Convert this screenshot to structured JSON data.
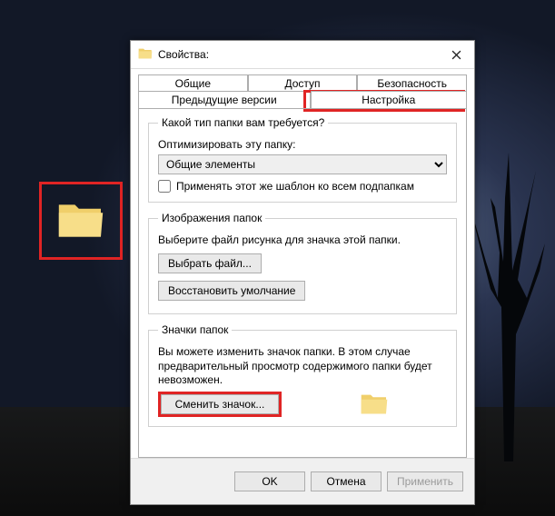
{
  "window": {
    "title": "Свойства:",
    "close_label": "Закрыть"
  },
  "tabs": {
    "general": "Общие",
    "sharing": "Доступ",
    "security": "Безопасность",
    "previous": "Предыдущие версии",
    "customize": "Настройка"
  },
  "group_type": {
    "legend": "Какой тип папки вам требуется?",
    "optimize_label": "Оптимизировать эту папку:",
    "combo_value": "Общие элементы",
    "apply_sub": "Применять этот же шаблон ко всем подпапкам"
  },
  "group_images": {
    "legend": "Изображения папок",
    "desc": "Выберите файл рисунка для значка этой папки.",
    "choose_btn": "Выбрать файл...",
    "restore_btn": "Восстановить умолчание"
  },
  "group_icons": {
    "legend": "Значки папок",
    "desc": "Вы можете изменить значок папки. В этом случае предварительный просмотр содержимого папки будет невозможен.",
    "change_btn": "Сменить значок..."
  },
  "buttons": {
    "ok": "OK",
    "cancel": "Отмена",
    "apply": "Применить"
  },
  "icons": {
    "folder": "folder-icon",
    "close": "close-icon"
  },
  "highlight_color": "#e02424"
}
